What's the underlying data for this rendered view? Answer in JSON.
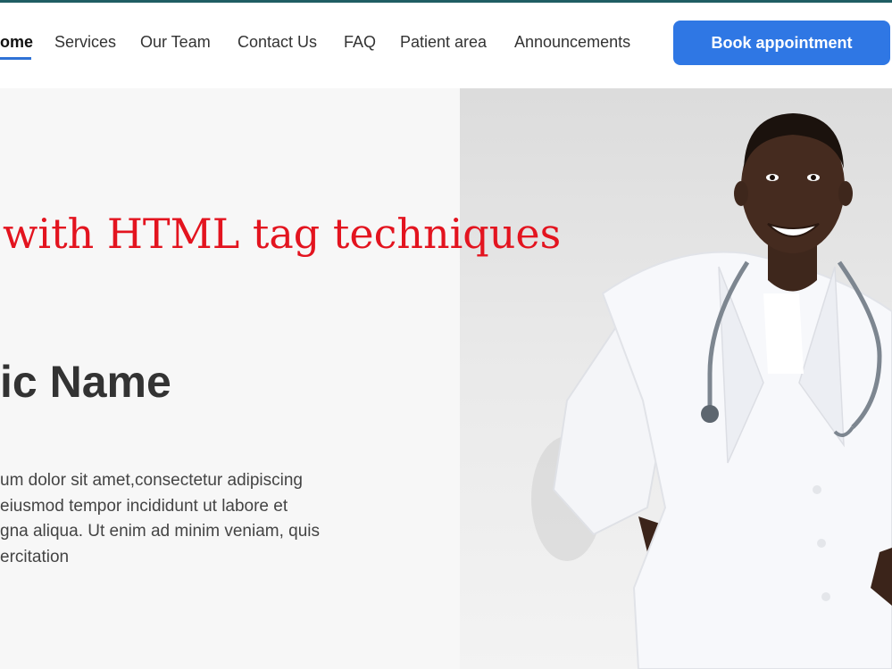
{
  "nav": {
    "items": [
      {
        "label": "ome"
      },
      {
        "label": "Services"
      },
      {
        "label": "Our Team"
      },
      {
        "label": "Contact Us"
      },
      {
        "label": "FAQ"
      },
      {
        "label": "Patient area"
      },
      {
        "label": "Announcements"
      }
    ],
    "book_label": "Book appointment"
  },
  "hero": {
    "promo": "with HTML tag techniques",
    "clinic_name": "ic Name",
    "description_lines": [
      "um dolor sit amet,consectetur adipiscing",
      "eiusmod tempor incididunt ut labore et",
      "gna aliqua. Ut enim ad minim veniam, quis",
      "ercitation"
    ],
    "image_icon": "doctor-photo"
  },
  "colors": {
    "accent": "#2f77e4",
    "promo": "#e3141f",
    "topline": "#1f5d63"
  }
}
